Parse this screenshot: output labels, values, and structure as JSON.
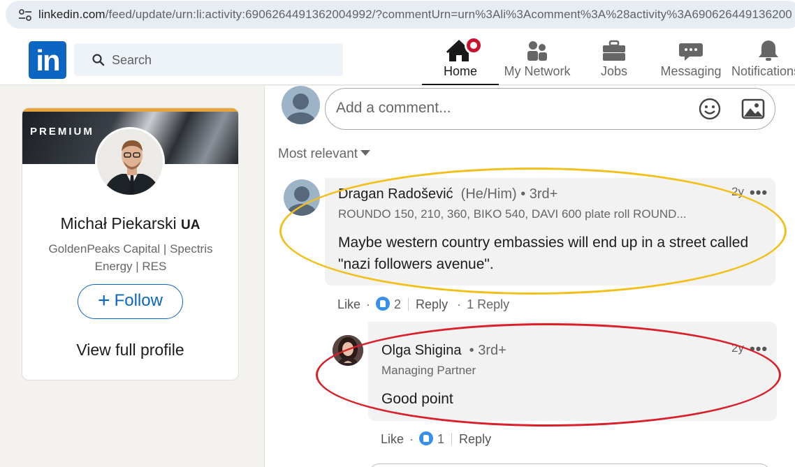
{
  "browser": {
    "url_host": "linkedin.com",
    "url_rest": "/feed/update/urn:li:activity:6906264491362004992/?commentUrn=urn%3Ali%3Acomment%3A%28activity%3A690626449136200"
  },
  "header": {
    "logo_text": "in",
    "search_placeholder": "Search",
    "nav": [
      {
        "label": "Home",
        "icon": "home-icon",
        "active": true
      },
      {
        "label": "My Network",
        "icon": "network-icon"
      },
      {
        "label": "Jobs",
        "icon": "briefcase-icon"
      },
      {
        "label": "Messaging",
        "icon": "messaging-icon"
      },
      {
        "label": "Notifications",
        "icon": "bell-icon"
      }
    ]
  },
  "profile_card": {
    "premium_label": "PREMIUM",
    "name": "Michał Piekarski",
    "name_suffix": "UA",
    "headline": "GoldenPeaks Capital | Spectris Energy | RES",
    "follow_label": "Follow",
    "view_profile_label": "View full profile"
  },
  "comment_input": {
    "placeholder": "Add a comment..."
  },
  "sort": {
    "label": "Most relevant"
  },
  "comments": [
    {
      "author": "Dragan Radošević",
      "pronouns": "(He/Him)",
      "degree": "• 3rd+",
      "subtitle": "ROUNDO 150, 210, 360, BIKO 540, DAVI 600 plate roll ROUND...",
      "text": "Maybe western country embassies will end up in a street called \"nazi followers avenue\".",
      "time": "2y",
      "like_label": "Like",
      "reaction_count": "2",
      "reply_label": "Reply",
      "replies_label": "1 Reply"
    },
    {
      "author": "Olga Shigina",
      "degree": "• 3rd+",
      "subtitle": "Managing Partner",
      "text": "Good point",
      "time": "2y",
      "like_label": "Like",
      "reaction_count": "1",
      "reply_label": "Reply"
    }
  ],
  "colors": {
    "brand": "#0a66c2",
    "highlight_yellow": "#f2c01a",
    "highlight_red": "#d9202a",
    "notification_badge": "#cb112d"
  }
}
